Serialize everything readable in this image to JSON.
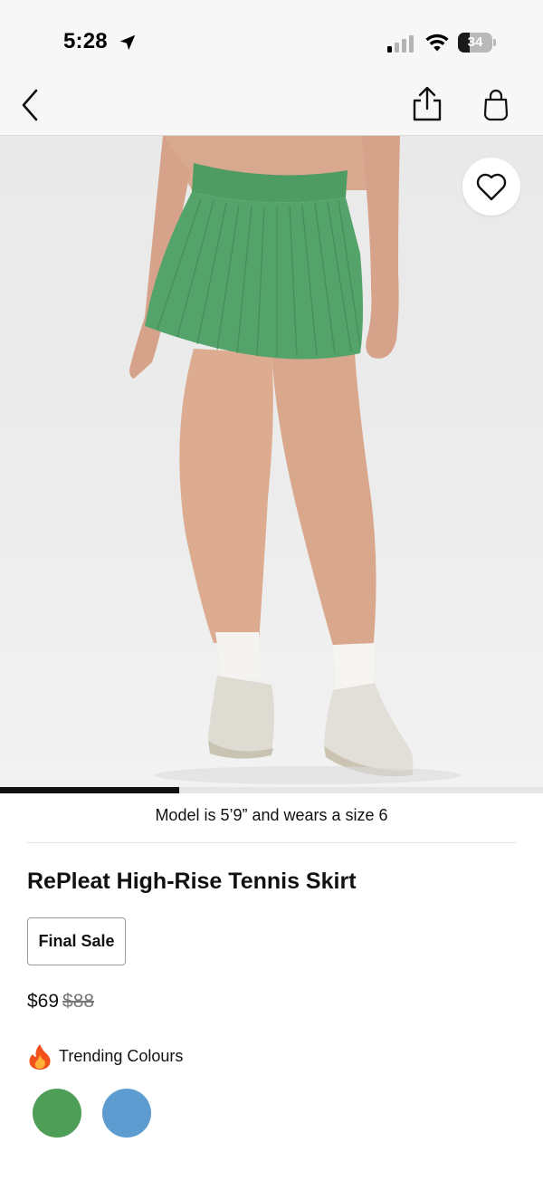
{
  "status_bar": {
    "time": "5:28",
    "battery_level": "34",
    "battery_fraction": 0.34
  },
  "nav": {
    "back_icon": "chevron-left-icon",
    "share_icon": "share-icon",
    "bag_icon": "shopping-bag-icon"
  },
  "product": {
    "image_description_icon": "product-photo",
    "wishlist_icon": "heart-icon",
    "carousel_progress": 0.33,
    "model_note": "Model is 5’9” and wears a size 6",
    "title": "RePleat High-Rise Tennis Skirt",
    "badge": "Final Sale",
    "price_sale": "$69",
    "price_original": "$88",
    "trending_icon": "fire-icon",
    "trending_label": "Trending Colours",
    "swatches": [
      {
        "color": "#4e9e57"
      },
      {
        "color": "#5d9cd0"
      }
    ]
  }
}
